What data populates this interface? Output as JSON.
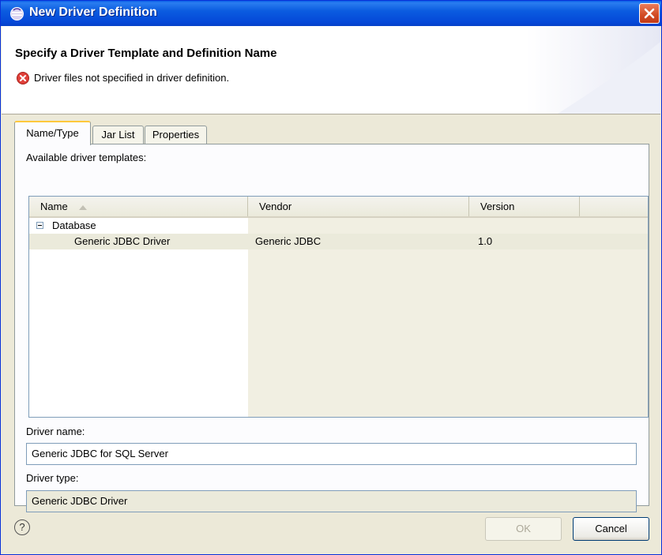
{
  "window": {
    "title": "New Driver Definition"
  },
  "header": {
    "title": "Specify a Driver Template and Definition Name",
    "message": "Driver files not specified in driver definition."
  },
  "tabs": [
    {
      "label": "Name/Type",
      "active": true
    },
    {
      "label": "Jar List",
      "active": false
    },
    {
      "label": "Properties",
      "active": false
    }
  ],
  "templates": {
    "label": "Available driver templates:",
    "columns": [
      "Name",
      "Vendor",
      "Version"
    ],
    "sort_column": "Name",
    "sort_direction": "ascending",
    "category": "Database",
    "rows": [
      {
        "name": "Generic JDBC Driver",
        "vendor": "Generic JDBC",
        "version": "1.0"
      }
    ]
  },
  "driver_name": {
    "label": "Driver name:",
    "value": "Generic JDBC for SQL Server"
  },
  "driver_type": {
    "label": "Driver type:",
    "value": "Generic JDBC Driver"
  },
  "buttons": {
    "ok": "OK",
    "ok_enabled": false,
    "cancel": "Cancel"
  },
  "help": {
    "icon": "help-icon",
    "glyph": "?"
  },
  "colors": {
    "titlebar": "#0a5fe8",
    "tab_accent": "#ffc83c",
    "error": "#e0403a"
  }
}
